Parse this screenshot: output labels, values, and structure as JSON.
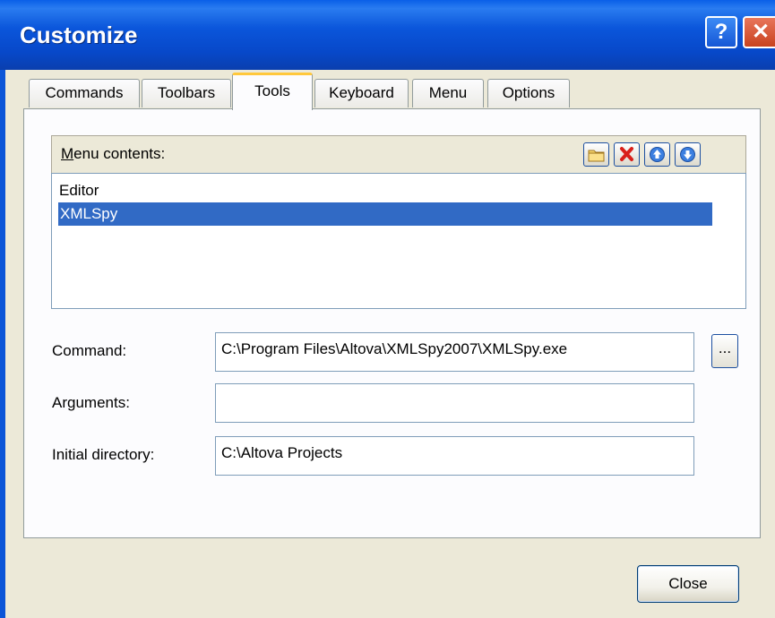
{
  "window": {
    "title": "Customize",
    "help_glyph": "?",
    "close_glyph": "✕"
  },
  "tabs": [
    {
      "label": "Commands",
      "active": false
    },
    {
      "label": "Toolbars",
      "active": false
    },
    {
      "label": "Tools",
      "active": true
    },
    {
      "label": "Keyboard",
      "active": false
    },
    {
      "label": "Menu",
      "active": false
    },
    {
      "label": "Options",
      "active": false
    }
  ],
  "menu_contents": {
    "label_prefix": "M",
    "label_rest": "enu contents:",
    "toolbar_icons": [
      "new-folder-icon",
      "delete-icon",
      "move-up-icon",
      "move-down-icon"
    ],
    "items": [
      {
        "label": "Editor",
        "selected": false
      },
      {
        "label": "XMLSpy",
        "selected": true
      }
    ]
  },
  "form": {
    "command_label": "Command:",
    "command_value": "C:\\Program Files\\Altova\\XMLSpy2007\\XMLSpy.exe",
    "browse_label": "...",
    "arguments_label": "Arguments:",
    "arguments_value": "",
    "initial_dir_label": "Initial directory:",
    "initial_dir_value": "C:\\Altova Projects"
  },
  "footer": {
    "close_label": "Close"
  },
  "colors": {
    "titlebar": "#0b56db",
    "selection": "#316ac5",
    "dialog_bg": "#ece9d8",
    "active_tab_accent": "#ffc83c"
  }
}
